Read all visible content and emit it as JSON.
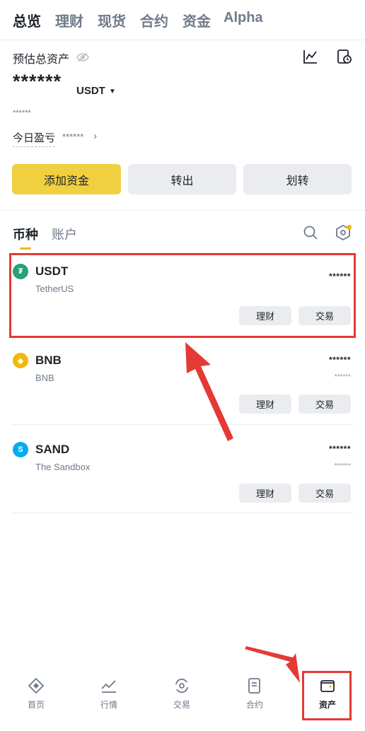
{
  "top_tabs": [
    "总览",
    "理财",
    "现货",
    "合约",
    "资金",
    "Alpha"
  ],
  "overview": {
    "label": "预估总资产",
    "masked_total": "******",
    "unit": "USDT",
    "masked_sub": "******",
    "pnl_label": "今日盈亏",
    "pnl_value": "******"
  },
  "actions": [
    "添加资金",
    "转出",
    "划转"
  ],
  "asset_tabs": [
    "币种",
    "账户"
  ],
  "coins": [
    {
      "symbol": "USDT",
      "name": "TetherUS",
      "balance": "******",
      "sub": "",
      "color": "#26a17b",
      "icon_name": "tether-icon",
      "glyph": "₮"
    },
    {
      "symbol": "BNB",
      "name": "BNB",
      "balance": "******",
      "sub": "******",
      "color": "#f0b90b",
      "icon_name": "bnb-icon",
      "glyph": "◆"
    },
    {
      "symbol": "SAND",
      "name": "The Sandbox",
      "balance": "******",
      "sub": "******",
      "color": "#00adef",
      "icon_name": "sandbox-icon",
      "glyph": "S"
    }
  ],
  "row_buttons": {
    "earn": "理财",
    "trade": "交易"
  },
  "bottom_nav": [
    "首页",
    "行情",
    "交易",
    "合约",
    "资产"
  ],
  "colors": {
    "accent": "#f0d040",
    "highlight": "#e53935"
  }
}
